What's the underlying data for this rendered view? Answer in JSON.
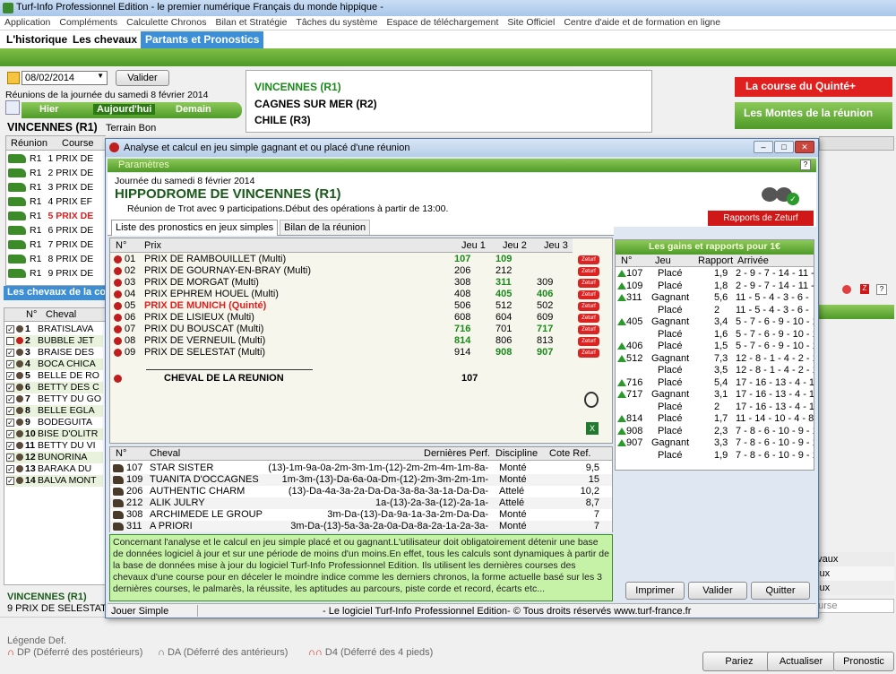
{
  "window": {
    "title": "Turf-Info Professionnel Edition - le premier numérique Français du monde hippique -"
  },
  "menu": [
    "Application",
    "Compléments",
    "Calculette Chronos",
    "Bilan et Stratégie",
    "Tâches du système",
    "Espace de téléchargement",
    "Site Officiel",
    "Centre d'aide et de formation en ligne"
  ],
  "tabs": {
    "history": "L'historique",
    "horses": "Les chevaux",
    "starters": "Partants et Pronostics"
  },
  "date_panel": {
    "date": "08/02/2014",
    "validate": "Valider",
    "reunions_title": "Réunions de la journée du samedi 8 février 2014",
    "yesterday": "Hier",
    "today": "Aujourd'hui",
    "tomorrow": "Demain"
  },
  "reunions": [
    "VINCENNES (R1)",
    "CAGNES SUR MER (R2)",
    "CHILE (R3)"
  ],
  "right_buttons": {
    "quinte": "La course du Quinté+",
    "montes": "Les Montes de la réunion"
  },
  "left": {
    "track": "VINCENNES (R1)",
    "ground": "Terrain Bon",
    "col_reunion": "Réunion",
    "col_course": "Course",
    "races": [
      {
        "r": "R1",
        "c": "1 PRIX DE"
      },
      {
        "r": "R1",
        "c": "2 PRIX DE"
      },
      {
        "r": "R1",
        "c": "3 PRIX DE"
      },
      {
        "r": "R1",
        "c": "4 PRIX EF"
      },
      {
        "r": "R1",
        "c": "5 PRIX DE"
      },
      {
        "r": "R1",
        "c": "6 PRIX DE"
      },
      {
        "r": "R1",
        "c": "7 PRIX DE"
      },
      {
        "r": "R1",
        "c": "8 PRIX DE"
      },
      {
        "r": "R1",
        "c": "9 PRIX DE"
      }
    ],
    "horses_header": "Les chevaux de la co",
    "col_num": "N°",
    "col_horse": "Cheval",
    "horses": [
      {
        "n": "1",
        "name": "BRATISLAVA"
      },
      {
        "n": "2",
        "name": "BUBBLE JET"
      },
      {
        "n": "3",
        "name": "BRAISE DES"
      },
      {
        "n": "4",
        "name": "BOCA CHICA"
      },
      {
        "n": "5",
        "name": "BELLE DE RO"
      },
      {
        "n": "6",
        "name": "BETTY DES C"
      },
      {
        "n": "7",
        "name": "BETTY DU GO"
      },
      {
        "n": "8",
        "name": "BELLE EGLA"
      },
      {
        "n": "9",
        "name": "BODEGUITA"
      },
      {
        "n": "10",
        "name": "BISE D'OLITR"
      },
      {
        "n": "11",
        "name": "BETTY DU VI"
      },
      {
        "n": "12",
        "name": "BUNORINA"
      },
      {
        "n": "13",
        "name": "BARAKA DU"
      },
      {
        "n": "14",
        "name": "BALVA MONT"
      }
    ],
    "footer_track": "VINCENNES (R1)",
    "footer_race": "9 PRIX DE SELESTAT"
  },
  "legend": {
    "title": "Légende Def.",
    "dp": "DP (Déferré des postérieurs)",
    "da": "DA (Déferré des antérieurs)",
    "d4": "D4 (Déferré des 4 pieds)"
  },
  "bottom_buttons": {
    "pariez": "Pariez",
    "actualiser": "Actualiser",
    "pronostic": "Pronostic"
  },
  "right_panel_fragments": [
    "avaux",
    "jeux",
    "jeux",
    "ourse"
  ],
  "dialog": {
    "title": "Analyse et calcul en jeu simple gagnant et ou placé d'une réunion",
    "params": "Paramètres",
    "day": "Journée du samedi 8 février 2014",
    "hippodrome": "HIPPODROME DE  VINCENNES (R1)",
    "info": "Réunion de Trot avec 9 participations.Début des opérations à partir de 13:00.",
    "rapports_button": "Rapports de Zeturf",
    "tab_list": "Liste des pronostics en jeux simples",
    "tab_bilan": "Bilan de la réunion",
    "cols": {
      "n": "N°",
      "prix": "Prix",
      "j1": "Jeu 1",
      "j2": "Jeu 2",
      "j3": "Jeu 3"
    },
    "races": [
      {
        "n": "01",
        "prix": "PRIX DE RAMBOUILLET (Multi)",
        "j1": "107",
        "j2": "109",
        "j3": ""
      },
      {
        "n": "02",
        "prix": "PRIX DE GOURNAY-EN-BRAY (Multi)",
        "j1": "206",
        "j2": "212",
        "j3": ""
      },
      {
        "n": "03",
        "prix": "PRIX DE MORGAT (Multi)",
        "j1": "308",
        "j2": "311",
        "j3": "309"
      },
      {
        "n": "04",
        "prix": "PRIX EPHREM HOUEL (Multi)",
        "j1": "408",
        "j2": "405",
        "j3": "406"
      },
      {
        "n": "05",
        "prix": "PRIX DE MUNICH (Quinté)",
        "j1": "506",
        "j2": "512",
        "j3": "502"
      },
      {
        "n": "06",
        "prix": "PRIX DE LISIEUX (Multi)",
        "j1": "608",
        "j2": "604",
        "j3": "609"
      },
      {
        "n": "07",
        "prix": "PRIX DU BOUSCAT (Multi)",
        "j1": "716",
        "j2": "701",
        "j3": "717"
      },
      {
        "n": "08",
        "prix": "PRIX DE VERNEUIL (Multi)",
        "j1": "814",
        "j2": "806",
        "j3": "813"
      },
      {
        "n": "09",
        "prix": "PRIX DE SELESTAT (Multi)",
        "j1": "914",
        "j2": "908",
        "j3": "907"
      }
    ],
    "cheval_reunion_label": "CHEVAL DE LA REUNION",
    "cheval_reunion_value": "107",
    "zeturf_badge": "Zeturf",
    "gains_title": "Les gains et rapports pour 1€",
    "gains_cols": {
      "n": "N°",
      "jeu": "Jeu",
      "rapport": "Rapport",
      "arrivee": "Arrivée"
    },
    "gains": [
      {
        "n": "107",
        "jeu": "Placé",
        "rapport": "1,9",
        "arrivee": "2 - 9 - 7 - 14 - 11 -"
      },
      {
        "n": "109",
        "jeu": "Placé",
        "rapport": "1,8",
        "arrivee": "2 - 9 - 7 - 14 - 11 -"
      },
      {
        "n": "311",
        "jeu": "Gagnant",
        "rapport": "5,6",
        "arrivee": "11 - 5 - 4 - 3 - 6 -"
      },
      {
        "n": "",
        "jeu": "Placé",
        "rapport": "2",
        "arrivee": "11 - 5 - 4 - 3 - 6 -"
      },
      {
        "n": "405",
        "jeu": "Gagnant",
        "rapport": "3,4",
        "arrivee": "5 - 7 - 6 - 9 - 10 - 1"
      },
      {
        "n": "",
        "jeu": "Placé",
        "rapport": "1,6",
        "arrivee": "5 - 7 - 6 - 9 - 10 - 1"
      },
      {
        "n": "406",
        "jeu": "Placé",
        "rapport": "1,5",
        "arrivee": "5 - 7 - 6 - 9 - 10 - 1"
      },
      {
        "n": "512",
        "jeu": "Gagnant",
        "rapport": "7,3",
        "arrivee": "12 - 8 - 1 - 4 - 2 - 1"
      },
      {
        "n": "",
        "jeu": "Placé",
        "rapport": "3,5",
        "arrivee": "12 - 8 - 1 - 4 - 2 - 1"
      },
      {
        "n": "716",
        "jeu": "Placé",
        "rapport": "5,4",
        "arrivee": "17 - 16 - 13 - 4 - 15"
      },
      {
        "n": "717",
        "jeu": "Gagnant",
        "rapport": "3,1",
        "arrivee": "17 - 16 - 13 - 4 - 15"
      },
      {
        "n": "",
        "jeu": "Placé",
        "rapport": "2",
        "arrivee": "17 - 16 - 13 - 4 - 15"
      },
      {
        "n": "814",
        "jeu": "Placé",
        "rapport": "1,7",
        "arrivee": "11 - 14 - 10 - 4 - 8 -"
      },
      {
        "n": "908",
        "jeu": "Placé",
        "rapport": "2,3",
        "arrivee": "7 - 8 - 6 - 10 - 9 - 1"
      },
      {
        "n": "907",
        "jeu": "Gagnant",
        "rapport": "3,3",
        "arrivee": "7 - 8 - 6 - 10 - 9 - 1"
      },
      {
        "n": "",
        "jeu": "Placé",
        "rapport": "1,9",
        "arrivee": "7 - 8 - 6 - 10 - 9 - 1"
      }
    ],
    "horse_cols": {
      "n": "N°",
      "cheval": "Cheval",
      "perf": "Dernières Perf.",
      "disc": "Discipline",
      "cote": "Cote Ref."
    },
    "horse_rows": [
      {
        "n": "107",
        "cheval": "STAR SISTER",
        "perf": "(13)-1m-9a-0a-2m-3m-1m-(12)-2m-2m-4m-1m-8a-",
        "disc": "Monté",
        "cote": "9,5"
      },
      {
        "n": "109",
        "cheval": "TUANITA D'OCCAGNES",
        "perf": "1m-3m-(13)-Da-6a-0a-Dm-(12)-2m-3m-2m-1m-",
        "disc": "Monté",
        "cote": "15"
      },
      {
        "n": "206",
        "cheval": "AUTHENTIC CHARM",
        "perf": "(13)-Da-4a-3a-2a-Da-Da-3a-8a-3a-1a-Da-Da-",
        "disc": "Attelé",
        "cote": "10,2"
      },
      {
        "n": "212",
        "cheval": "ALIK JULRY",
        "perf": "1a-(13)-2a-3a-(12)-2a-1a-",
        "disc": "Attelé",
        "cote": "8,7"
      },
      {
        "n": "308",
        "cheval": "ARCHIMEDE LE GROUP",
        "perf": "3m-Da-(13)-Da-9a-1a-3a-2m-Da-Da-",
        "disc": "Monté",
        "cote": "7"
      },
      {
        "n": "311",
        "cheval": "A PRIORI",
        "perf": "3m-Da-(13)-5a-3a-2a-0a-Da-8a-2a-1a-2a-3a-",
        "disc": "Monté",
        "cote": "7"
      }
    ],
    "note": "Concernant l'analyse et le calcul en jeu simple placé et ou gagnant.L'utilisateur doit obligatoirement détenir une base de données logiciel à jour et sur une période de moins d'un moins.En effet, tous les calculs sont dynamiques à partir de la base de données mise à jour du logiciel Turf-Info Professionnel  Edition. Ils utilisent les dernières courses des chevaux d'une course pour en déceler le moindre indice comme les derniers chronos, la forme actuelle basé sur les 3 dernières courses, le palmarès, la réussite, les aptitudes au parcours, piste corde et record, écarts etc...",
    "print": "Imprimer",
    "validate": "Valider",
    "quit": "Quitter",
    "status_left": "Jouer Simple",
    "status_right": "- Le logiciel Turf-Info Professionnel Edition- © Tous droits réservés www.turf-france.fr"
  },
  "colors": {
    "green": "#4f9a28",
    "red": "#e01f1f",
    "blue_tab": "#3c8fd6"
  }
}
